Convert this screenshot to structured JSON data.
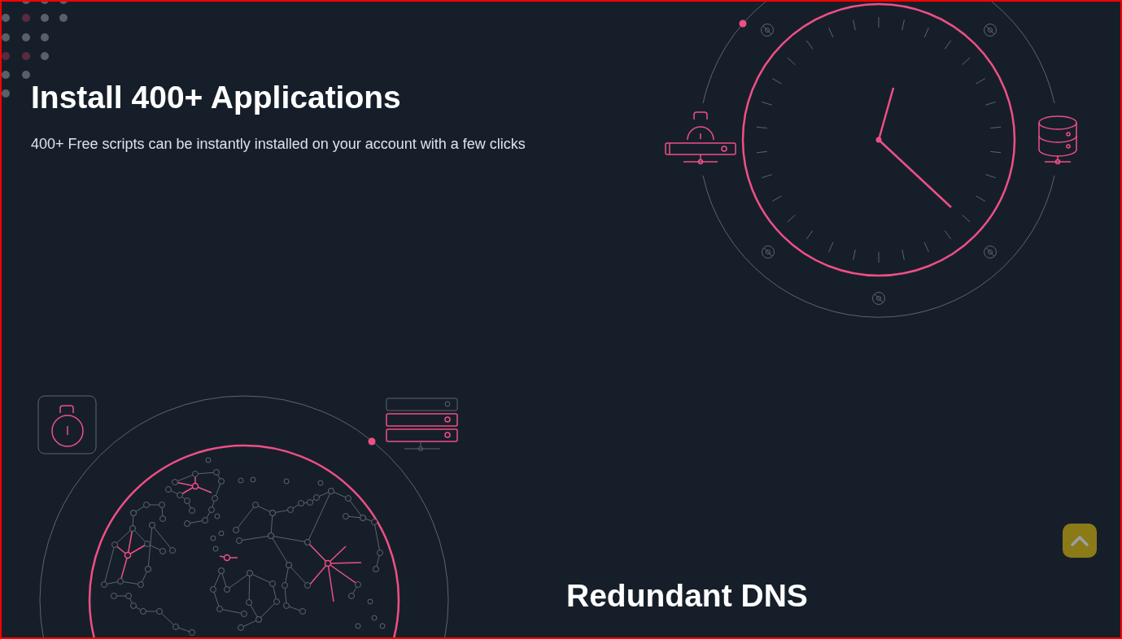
{
  "features": [
    {
      "title": "Install 400+ Applications",
      "description": "400+ Free scripts can be instantly installed on your account with a few clicks"
    },
    {
      "title": "Redundant DNS"
    }
  ]
}
